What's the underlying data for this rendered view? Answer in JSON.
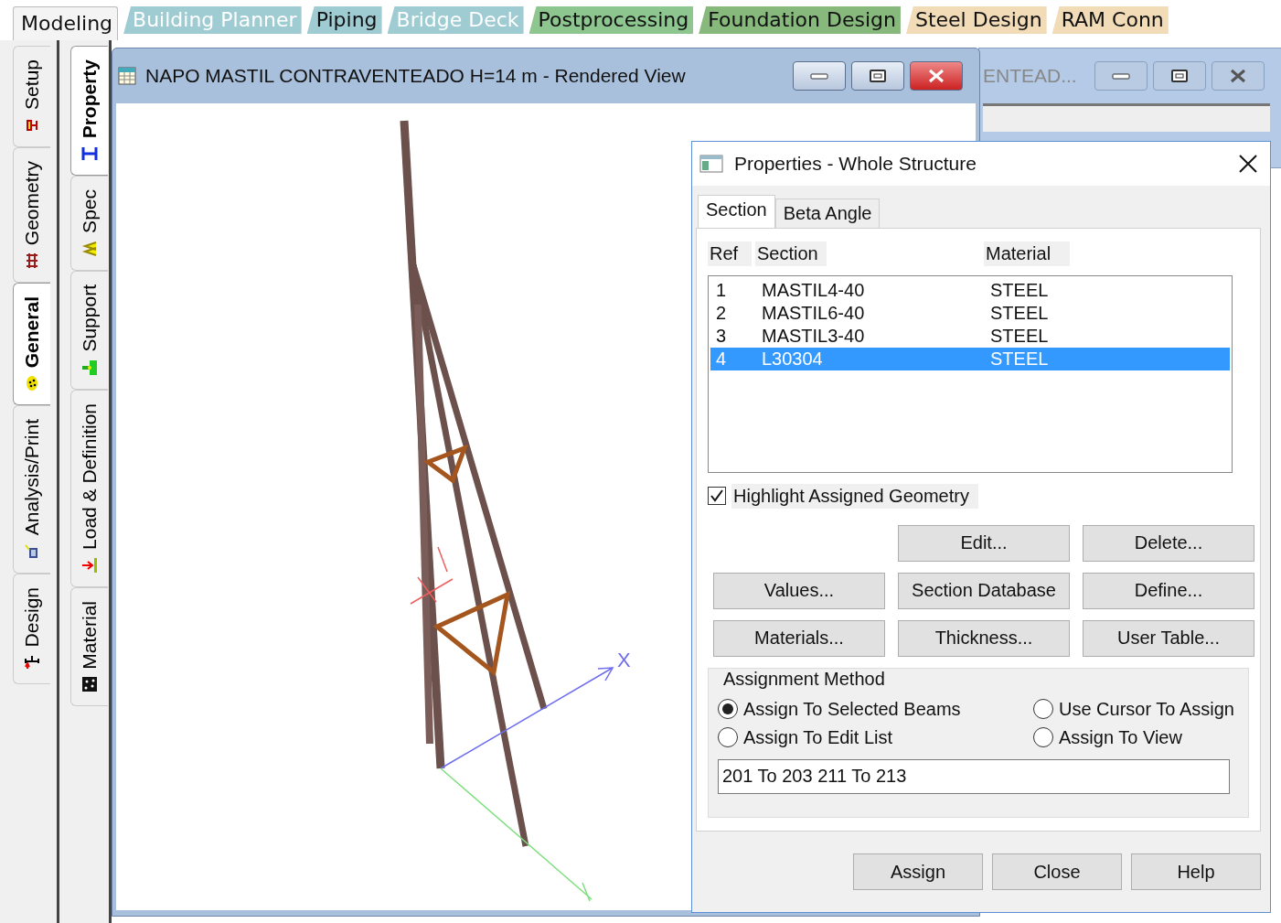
{
  "ribbon_tabs": [
    {
      "label": "Modeling",
      "selected": true,
      "disabled": false,
      "color": "#f4f4f4"
    },
    {
      "label": "Building Planner",
      "selected": false,
      "disabled": true,
      "color": "#9fcbd2"
    },
    {
      "label": "Piping",
      "selected": false,
      "disabled": false,
      "color": "#9fcbd2"
    },
    {
      "label": "Bridge Deck",
      "selected": false,
      "disabled": true,
      "color": "#9fcbd2"
    },
    {
      "label": "Postprocessing",
      "selected": false,
      "disabled": false,
      "color": "#8dc68f"
    },
    {
      "label": "Foundation Design",
      "selected": false,
      "disabled": false,
      "color": "#87b97c"
    },
    {
      "label": "Steel Design",
      "selected": false,
      "disabled": false,
      "color": "#f2dcb8"
    },
    {
      "label": "RAM Conn",
      "selected": false,
      "disabled": false,
      "color": "#f2dcb8"
    }
  ],
  "page_tabs": [
    {
      "label": "Design",
      "selected": false
    },
    {
      "label": "Analysis/Print",
      "selected": false
    },
    {
      "label": "General",
      "selected": true
    },
    {
      "label": "Geometry",
      "selected": false
    },
    {
      "label": "Setup",
      "selected": false
    }
  ],
  "sub_tabs": [
    {
      "label": "Material",
      "selected": false
    },
    {
      "label": "Load & Definition",
      "selected": false
    },
    {
      "label": "Support",
      "selected": false
    },
    {
      "label": "Spec",
      "selected": false
    },
    {
      "label": "Property",
      "selected": true
    }
  ],
  "view_window": {
    "title": "NAPO MASTIL CONTRAVENTEADO H=14 m - Rendered View",
    "axis_label": "X"
  },
  "back_window": {
    "title": "ENTEAD..."
  },
  "dialog": {
    "title": "Properties - Whole Structure",
    "tabs": [
      {
        "label": "Section",
        "selected": true
      },
      {
        "label": "Beta Angle",
        "selected": false
      }
    ],
    "columns": [
      "Ref",
      "Section",
      "Material"
    ],
    "rows": [
      {
        "ref": "1",
        "section": "MASTIL4-40",
        "material": "STEEL",
        "selected": false
      },
      {
        "ref": "2",
        "section": "MASTIL6-40",
        "material": "STEEL",
        "selected": false
      },
      {
        "ref": "3",
        "section": "MASTIL3-40",
        "material": "STEEL",
        "selected": false
      },
      {
        "ref": "4",
        "section": "L30304",
        "material": "STEEL",
        "selected": true
      }
    ],
    "highlight": {
      "label": "Highlight Assigned Geometry",
      "checked": true
    },
    "buttons": [
      [
        "Edit...",
        "Delete..."
      ],
      [
        "Values...",
        "Section Database",
        "Define..."
      ],
      [
        "Materials...",
        "Thickness...",
        "User Table..."
      ]
    ],
    "assignment": {
      "title": "Assignment Method",
      "options": [
        {
          "label": "Assign To Selected Beams",
          "selected": true
        },
        {
          "label": "Use Cursor To Assign",
          "selected": false
        },
        {
          "label": "Assign To Edit List",
          "selected": false
        },
        {
          "label": "Assign To View",
          "selected": false
        }
      ],
      "value": "201 To 203 211 To 213"
    },
    "footer_buttons": [
      "Assign",
      "Close",
      "Help"
    ]
  }
}
